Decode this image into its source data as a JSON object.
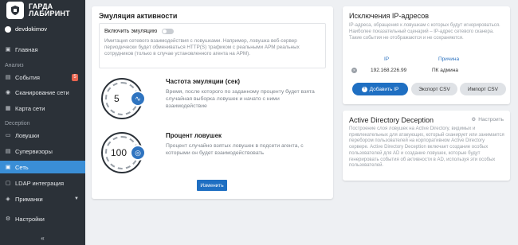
{
  "sidebar": {
    "logo_line1": "ГАРДА",
    "logo_line2": "ЛАБИРИНТ",
    "user": "devdokimov",
    "items": [
      {
        "label": "Главная"
      },
      {
        "label": "События",
        "badge": "5"
      },
      {
        "label": "Сканирование сети"
      },
      {
        "label": "Карта сети"
      },
      {
        "label": "Ловушки"
      },
      {
        "label": "Супервизоры"
      },
      {
        "label": "Сеть"
      },
      {
        "label": "LDAP интеграция"
      },
      {
        "label": "Приманки"
      },
      {
        "label": "Настройки"
      }
    ],
    "sections": {
      "analysis": "Анализ",
      "deception": "Deception"
    },
    "collapse": "«"
  },
  "emulation": {
    "title": "Эмуляция активности",
    "toggle_label": "Включить эмуляцию",
    "toggle_on": false,
    "description": "Имитация сетевого взаимодействия с ловушками. Например, ловушка веб-сервер периодически будет обмениваться HTTP(S) трафиком с реальными АРМ реальных сотрудников (только в случае установленного агента на АРМ).",
    "frequency": {
      "title": "Частота эмуляции (сек)",
      "value": "5",
      "description": "Время, после которого по заданному проценту будет взята случайная выборка ловушек и начато с ними взаимодействие"
    },
    "percent": {
      "title": "Процент ловушек",
      "value": "100",
      "description": "Процент случайно взятых ловушек в подсети агента, с которыми он будет взаимодействовать"
    },
    "change_button": "Изменить"
  },
  "ip_exclusions": {
    "title": "Исключения IP-адресов",
    "description": "IP-адреса, обращения к ловушкам с которых будут игнорироваться. Наиболее показательный сценарий – IP-адрес сетевого сканера. Такие события не отображаются и не сохраняются.",
    "columns": [
      "IP",
      "Причина"
    ],
    "rows": [
      {
        "ip": "192.168.226.99",
        "reason": "ПК админа"
      }
    ],
    "add_button": "Добавить IP",
    "export_button": "Экспорт CSV",
    "import_button": "Импорт CSV"
  },
  "ad_deception": {
    "title": "Active Directory Deception",
    "settings_label": "Настроить",
    "description": "Построение слоя ловушек на Active Directory, видимых и привлекательных для атакующих, который сканирует или занимается перебором пользователей на корпоративном Active Directory сервере. Active Directory Deception включает создание особых пользователей для AD и создание ловушек, которые будут генерировать события об активности в AD, используя эти особых пользователей."
  }
}
